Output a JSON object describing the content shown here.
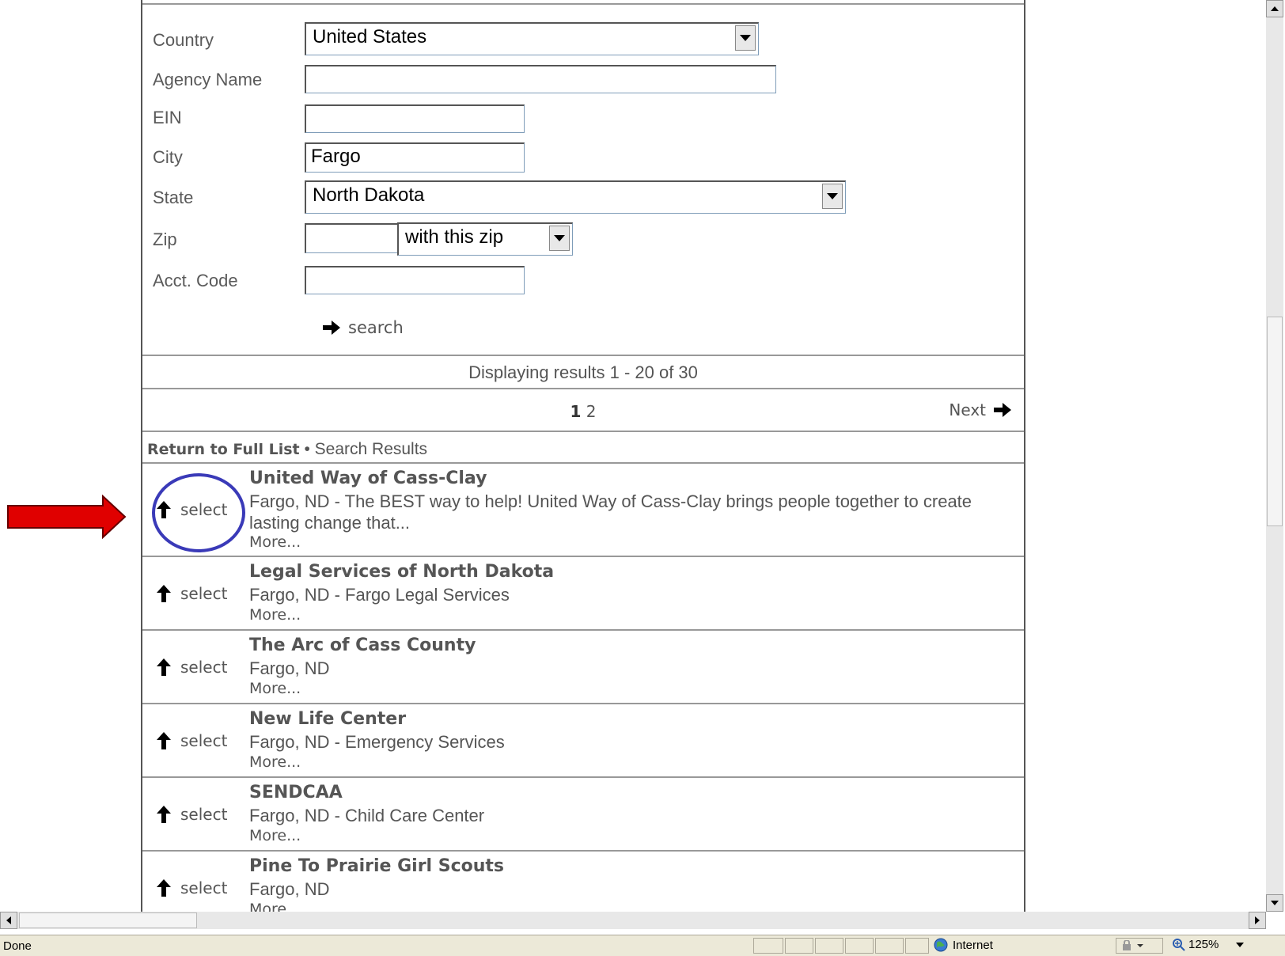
{
  "form": {
    "country_label": "Country",
    "country_value": "United States",
    "agency_label": "Agency Name",
    "agency_value": "",
    "ein_label": "EIN",
    "ein_value": "",
    "city_label": "City",
    "city_value": "Fargo",
    "state_label": "State",
    "state_value": "North Dakota",
    "zip_label": "Zip",
    "zip_value": "",
    "zip_mode": "with this zip",
    "acct_label": "Acct. Code",
    "acct_value": "",
    "search_label": "search"
  },
  "results": {
    "count_text": "Displaying results 1 - 20 of 30",
    "pages": [
      "1",
      "2"
    ],
    "current_page": "1",
    "next_label": "Next",
    "return_label": "Return to Full List",
    "separator": "•",
    "crumb_label": "Search Results",
    "select_label": "select",
    "more_label": "More...",
    "items": [
      {
        "name": "United Way of Cass-Clay",
        "desc": "Fargo, ND - The BEST way to help! United Way of Cass-Clay brings people together to create lasting change that..."
      },
      {
        "name": "Legal Services of North Dakota",
        "desc": "Fargo, ND - Fargo Legal Services"
      },
      {
        "name": "The Arc of Cass County",
        "desc": "Fargo, ND"
      },
      {
        "name": "New Life Center",
        "desc": "Fargo, ND - Emergency Services"
      },
      {
        "name": "SENDCAA",
        "desc": "Fargo, ND - Child Care Center"
      },
      {
        "name": "Pine To Prairie Girl Scouts",
        "desc": "Fargo, ND"
      }
    ]
  },
  "statusbar": {
    "status": "Done",
    "zone": "Internet",
    "zoom": "125%"
  },
  "colors": {
    "annotation_arrow": "#e00000",
    "annotation_circle": "#3a3ab8"
  }
}
